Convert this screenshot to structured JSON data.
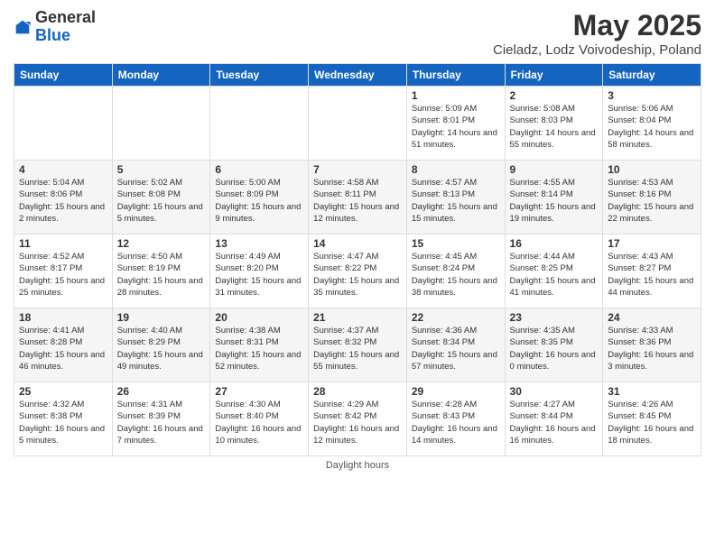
{
  "header": {
    "logo_general": "General",
    "logo_blue": "Blue",
    "title": "May 2025",
    "subtitle": "Cieladz, Lodz Voivodeship, Poland"
  },
  "days_of_week": [
    "Sunday",
    "Monday",
    "Tuesday",
    "Wednesday",
    "Thursday",
    "Friday",
    "Saturday"
  ],
  "weeks": [
    [
      {
        "day": "",
        "info": ""
      },
      {
        "day": "",
        "info": ""
      },
      {
        "day": "",
        "info": ""
      },
      {
        "day": "",
        "info": ""
      },
      {
        "day": "1",
        "info": "Sunrise: 5:09 AM\nSunset: 8:01 PM\nDaylight: 14 hours\nand 51 minutes."
      },
      {
        "day": "2",
        "info": "Sunrise: 5:08 AM\nSunset: 8:03 PM\nDaylight: 14 hours\nand 55 minutes."
      },
      {
        "day": "3",
        "info": "Sunrise: 5:06 AM\nSunset: 8:04 PM\nDaylight: 14 hours\nand 58 minutes."
      }
    ],
    [
      {
        "day": "4",
        "info": "Sunrise: 5:04 AM\nSunset: 8:06 PM\nDaylight: 15 hours\nand 2 minutes."
      },
      {
        "day": "5",
        "info": "Sunrise: 5:02 AM\nSunset: 8:08 PM\nDaylight: 15 hours\nand 5 minutes."
      },
      {
        "day": "6",
        "info": "Sunrise: 5:00 AM\nSunset: 8:09 PM\nDaylight: 15 hours\nand 9 minutes."
      },
      {
        "day": "7",
        "info": "Sunrise: 4:58 AM\nSunset: 8:11 PM\nDaylight: 15 hours\nand 12 minutes."
      },
      {
        "day": "8",
        "info": "Sunrise: 4:57 AM\nSunset: 8:13 PM\nDaylight: 15 hours\nand 15 minutes."
      },
      {
        "day": "9",
        "info": "Sunrise: 4:55 AM\nSunset: 8:14 PM\nDaylight: 15 hours\nand 19 minutes."
      },
      {
        "day": "10",
        "info": "Sunrise: 4:53 AM\nSunset: 8:16 PM\nDaylight: 15 hours\nand 22 minutes."
      }
    ],
    [
      {
        "day": "11",
        "info": "Sunrise: 4:52 AM\nSunset: 8:17 PM\nDaylight: 15 hours\nand 25 minutes."
      },
      {
        "day": "12",
        "info": "Sunrise: 4:50 AM\nSunset: 8:19 PM\nDaylight: 15 hours\nand 28 minutes."
      },
      {
        "day": "13",
        "info": "Sunrise: 4:49 AM\nSunset: 8:20 PM\nDaylight: 15 hours\nand 31 minutes."
      },
      {
        "day": "14",
        "info": "Sunrise: 4:47 AM\nSunset: 8:22 PM\nDaylight: 15 hours\nand 35 minutes."
      },
      {
        "day": "15",
        "info": "Sunrise: 4:45 AM\nSunset: 8:24 PM\nDaylight: 15 hours\nand 38 minutes."
      },
      {
        "day": "16",
        "info": "Sunrise: 4:44 AM\nSunset: 8:25 PM\nDaylight: 15 hours\nand 41 minutes."
      },
      {
        "day": "17",
        "info": "Sunrise: 4:43 AM\nSunset: 8:27 PM\nDaylight: 15 hours\nand 44 minutes."
      }
    ],
    [
      {
        "day": "18",
        "info": "Sunrise: 4:41 AM\nSunset: 8:28 PM\nDaylight: 15 hours\nand 46 minutes."
      },
      {
        "day": "19",
        "info": "Sunrise: 4:40 AM\nSunset: 8:29 PM\nDaylight: 15 hours\nand 49 minutes."
      },
      {
        "day": "20",
        "info": "Sunrise: 4:38 AM\nSunset: 8:31 PM\nDaylight: 15 hours\nand 52 minutes."
      },
      {
        "day": "21",
        "info": "Sunrise: 4:37 AM\nSunset: 8:32 PM\nDaylight: 15 hours\nand 55 minutes."
      },
      {
        "day": "22",
        "info": "Sunrise: 4:36 AM\nSunset: 8:34 PM\nDaylight: 15 hours\nand 57 minutes."
      },
      {
        "day": "23",
        "info": "Sunrise: 4:35 AM\nSunset: 8:35 PM\nDaylight: 16 hours\nand 0 minutes."
      },
      {
        "day": "24",
        "info": "Sunrise: 4:33 AM\nSunset: 8:36 PM\nDaylight: 16 hours\nand 3 minutes."
      }
    ],
    [
      {
        "day": "25",
        "info": "Sunrise: 4:32 AM\nSunset: 8:38 PM\nDaylight: 16 hours\nand 5 minutes."
      },
      {
        "day": "26",
        "info": "Sunrise: 4:31 AM\nSunset: 8:39 PM\nDaylight: 16 hours\nand 7 minutes."
      },
      {
        "day": "27",
        "info": "Sunrise: 4:30 AM\nSunset: 8:40 PM\nDaylight: 16 hours\nand 10 minutes."
      },
      {
        "day": "28",
        "info": "Sunrise: 4:29 AM\nSunset: 8:42 PM\nDaylight: 16 hours\nand 12 minutes."
      },
      {
        "day": "29",
        "info": "Sunrise: 4:28 AM\nSunset: 8:43 PM\nDaylight: 16 hours\nand 14 minutes."
      },
      {
        "day": "30",
        "info": "Sunrise: 4:27 AM\nSunset: 8:44 PM\nDaylight: 16 hours\nand 16 minutes."
      },
      {
        "day": "31",
        "info": "Sunrise: 4:26 AM\nSunset: 8:45 PM\nDaylight: 16 hours\nand 18 minutes."
      }
    ]
  ],
  "footer": {
    "daylight_label": "Daylight hours"
  }
}
